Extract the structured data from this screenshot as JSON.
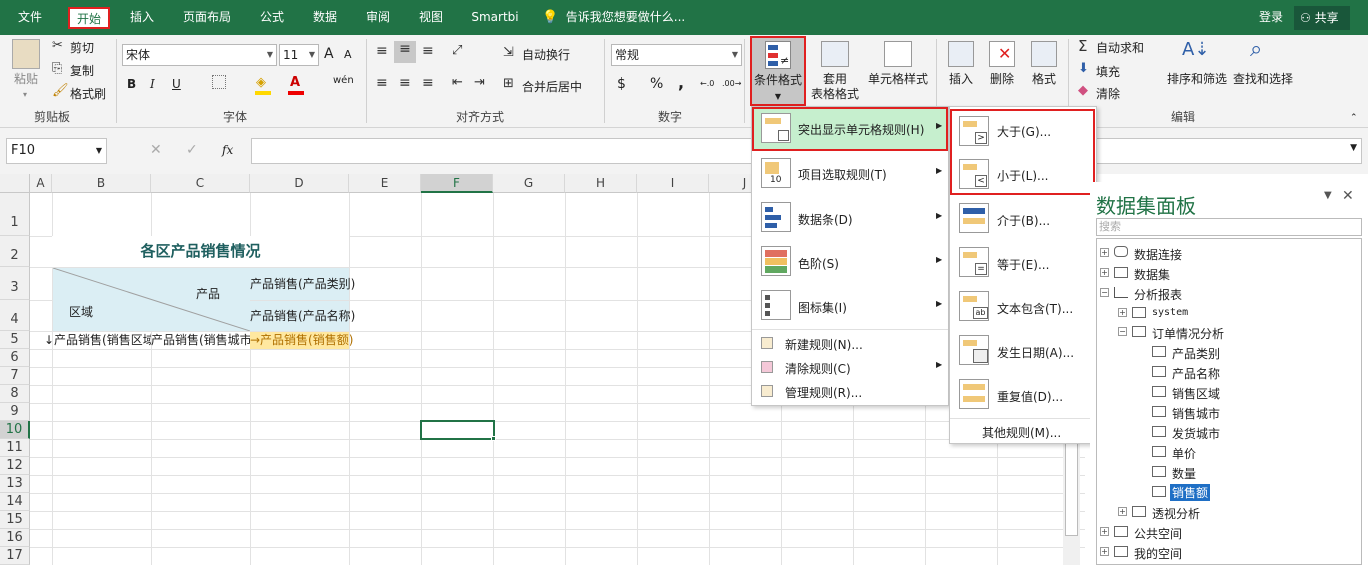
{
  "menubar": {
    "tabs": [
      "文件",
      "开始",
      "插入",
      "页面布局",
      "公式",
      "数据",
      "审阅",
      "视图",
      "Smartbi"
    ],
    "tell_me": "告诉我您想要做什么...",
    "login": "登录",
    "share": "共享"
  },
  "ribbon": {
    "clipboard": {
      "paste": "粘贴",
      "cut": "剪切",
      "copy": "复制",
      "format_painter": "格式刷",
      "label": "剪贴板"
    },
    "font": {
      "name": "宋体",
      "size": "11",
      "bold": "B",
      "italic": "I",
      "underline": "U",
      "grow": "A",
      "shrink": "A",
      "phonetic": "wén",
      "label": "字体"
    },
    "alignment": {
      "wrap": "自动换行",
      "merge": "合并后居中",
      "label": "对齐方式"
    },
    "number": {
      "format": "常规",
      "currency": "$",
      "percent": "%",
      "comma": ",",
      "label": "数字"
    },
    "styles": {
      "conditional": "条件格式",
      "table_format_1": "套用",
      "table_format_2": "表格格式",
      "cell_style": "单元格样式"
    },
    "cells": {
      "insert": "插入",
      "delete": "删除",
      "format": "格式"
    },
    "editing": {
      "autosum": "自动求和",
      "fill": "填充",
      "clear": "清除",
      "sort": "排序和筛选",
      "find": "查找和选择",
      "label": "编辑"
    }
  },
  "formula_bar": {
    "name_box": "F10",
    "fx": "fx",
    "value": ""
  },
  "sheet": {
    "columns": [
      "A",
      "B",
      "C",
      "D",
      "E",
      "F",
      "G",
      "H",
      "I",
      "J"
    ],
    "rows": [
      "1",
      "2",
      "3",
      "4",
      "5",
      "6",
      "7",
      "8",
      "9",
      "10",
      "11",
      "12",
      "13",
      "14",
      "15",
      "16",
      "17"
    ],
    "title": "各区产品销售情况",
    "header_product": "产品",
    "header_region": "区域",
    "d3": "产品销售(产品类别)",
    "d4": "产品销售(产品名称)",
    "b5": "↓产品销售(销售区域",
    "c5": "产品销售(销售城市",
    "d5": "→产品销售(销售额)",
    "selected_cell": "F10"
  },
  "cf_menu": {
    "items": [
      {
        "label": "突出显示单元格规则(H)",
        "icon": "highlight-rules-icon"
      },
      {
        "label": "项目选取规则(T)",
        "icon": "top-bottom-rules-icon"
      },
      {
        "label": "数据条(D)",
        "icon": "data-bars-icon"
      },
      {
        "label": "色阶(S)",
        "icon": "color-scales-icon"
      },
      {
        "label": "图标集(I)",
        "icon": "icon-sets-icon"
      }
    ],
    "small_items": [
      {
        "label": "新建规则(N)...",
        "icon": "new-rule-icon"
      },
      {
        "label": "清除规则(C)",
        "icon": "clear-rules-icon"
      },
      {
        "label": "管理规则(R)...",
        "icon": "manage-rules-icon"
      }
    ],
    "badge_top10": "10",
    "badge_lt": "<"
  },
  "highlight_submenu": {
    "items": [
      {
        "label": "大于(G)...",
        "badge": ">"
      },
      {
        "label": "小于(L)...",
        "badge": "<"
      },
      {
        "label": "介于(B)...",
        "badge": ""
      },
      {
        "label": "等于(E)...",
        "badge": "="
      },
      {
        "label": "文本包含(T)...",
        "badge": "ab"
      },
      {
        "label": "发生日期(A)...",
        "badge": ""
      },
      {
        "label": "重复值(D)...",
        "badge": ""
      }
    ],
    "more": "其他规则(M)..."
  },
  "panel": {
    "title": "数据集面板",
    "search_placeholder": "搜索",
    "tree": [
      {
        "label": "数据连接",
        "depth": 0,
        "expander": "+"
      },
      {
        "label": "数据集",
        "depth": 0,
        "expander": "+"
      },
      {
        "label": "分析报表",
        "depth": 0,
        "expander": "−"
      },
      {
        "label": "system",
        "depth": 1,
        "expander": "+"
      },
      {
        "label": "订单情况分析",
        "depth": 1,
        "expander": "−"
      },
      {
        "label": "产品类别",
        "depth": 2,
        "expander": ""
      },
      {
        "label": "产品名称",
        "depth": 2,
        "expander": ""
      },
      {
        "label": "销售区域",
        "depth": 2,
        "expander": ""
      },
      {
        "label": "销售城市",
        "depth": 2,
        "expander": ""
      },
      {
        "label": "发货城市",
        "depth": 2,
        "expander": ""
      },
      {
        "label": "单价",
        "depth": 2,
        "expander": ""
      },
      {
        "label": "数量",
        "depth": 2,
        "expander": ""
      },
      {
        "label": "销售额",
        "depth": 2,
        "expander": "",
        "selected": true
      },
      {
        "label": "透视分析",
        "depth": 1,
        "expander": "+"
      },
      {
        "label": "公共空间",
        "depth": 0,
        "expander": "+"
      },
      {
        "label": "我的空间",
        "depth": 0,
        "expander": "+"
      }
    ]
  },
  "colors": {
    "brand": "#217346",
    "highlight": "#e02020",
    "selection": "#1f6fc5",
    "menu_hover": "#c6efce"
  }
}
